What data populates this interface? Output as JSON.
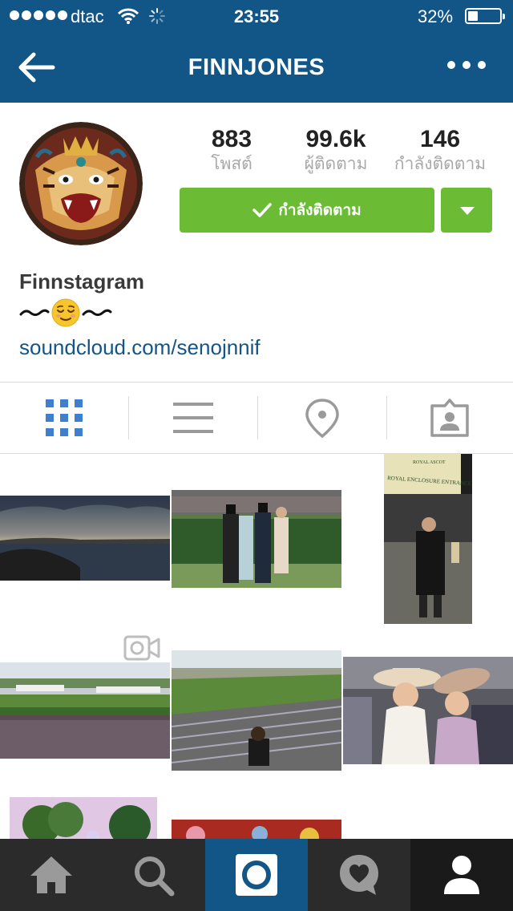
{
  "status_bar": {
    "carrier": "dtac",
    "time": "23:55",
    "battery_percent": "32%",
    "battery_level": 0.32,
    "signal_dots": 5
  },
  "nav": {
    "title": "FINNJONES",
    "back_icon": "back-arrow-icon",
    "more_icon": "more-dots-icon"
  },
  "profile": {
    "stats": [
      {
        "value": "883",
        "label": "โพสต์"
      },
      {
        "value": "99.6k",
        "label": "ผู้ติดตาม"
      },
      {
        "value": "146",
        "label": "กำลังติดตาม"
      }
    ],
    "follow_button": {
      "label": "กำลังติดตาม",
      "icon": "checkmark-icon"
    },
    "bio": {
      "name": "Finnstagram",
      "emoji_line": "〰😌〰",
      "link": "soundcloud.com/senojnnif"
    }
  },
  "tabs": [
    {
      "name": "grid-view",
      "icon": "grid-icon",
      "active": true
    },
    {
      "name": "list-view",
      "icon": "list-icon",
      "active": false
    },
    {
      "name": "photo-map",
      "icon": "map-pin-icon",
      "active": false
    },
    {
      "name": "photos-of-you",
      "icon": "tagged-person-icon",
      "active": false
    }
  ],
  "photo_labels": {
    "sign_line1": "ROYAL ASCOT",
    "sign_line2": "ROYAL ENCLOSURE ENTRANCE"
  },
  "tabbar": [
    {
      "name": "home",
      "icon": "home-icon"
    },
    {
      "name": "explore",
      "icon": "search-icon"
    },
    {
      "name": "camera",
      "icon": "camera-icon",
      "highlight": true
    },
    {
      "name": "activity",
      "icon": "heart-bubble-icon"
    },
    {
      "name": "profile",
      "icon": "profile-icon",
      "active": true
    }
  ],
  "colors": {
    "header_blue": "#125688",
    "follow_green": "#6bbb34",
    "link_blue": "#125688",
    "tabbar_dark": "#2b2b2b",
    "active_tab_blue": "#3f7fcf"
  }
}
